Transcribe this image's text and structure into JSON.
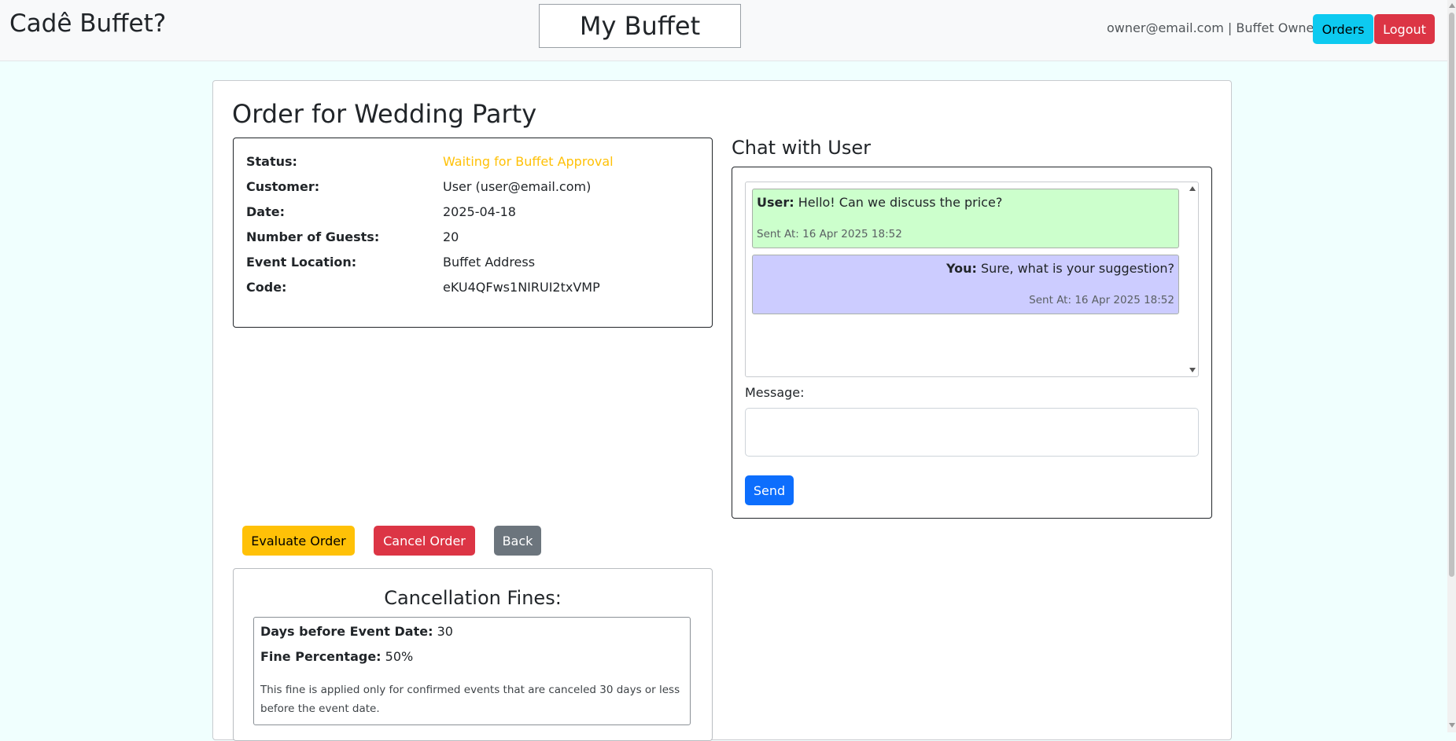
{
  "navbar": {
    "brand": "Cadê Buffet?",
    "my_buffet": "My Buffet",
    "user_info": "owner@email.com | Buffet Owner",
    "orders_label": "Orders",
    "logout_label": "Logout"
  },
  "page": {
    "title": "Order for Wedding Party"
  },
  "details": [
    {
      "label": "Status:",
      "value": "Waiting for Buffet Approval"
    },
    {
      "label": "Customer:",
      "value": "User (user@email.com)"
    },
    {
      "label": "Date:",
      "value": "2025-04-18"
    },
    {
      "label": "Number of Guests:",
      "value": "20"
    },
    {
      "label": "Event Location:",
      "value": "Buffet Address"
    },
    {
      "label": "Code:",
      "value": "eKU4QFws1NIRUI2txVMP"
    }
  ],
  "colors": {
    "status": "#ffc107",
    "user_message_bg": "#ccffcc",
    "own_message_bg": "#ccccff"
  },
  "chat": {
    "title": "Chat with User",
    "messages": [
      {
        "author": "User:",
        "text": " Hello! Can we discuss the price?",
        "sent": "Sent At: 16 Apr 2025 18:52"
      },
      {
        "author": "You:",
        "text": " Sure, what is your suggestion?",
        "sent": "Sent At: 16 Apr 2025 18:52"
      }
    ],
    "message_label": "Message:",
    "message_value": "",
    "send_label": "Send"
  },
  "actions": {
    "evaluate_label": "Evaluate Order",
    "cancel_label": "Cancel Order",
    "back_label": "Back"
  },
  "fines": {
    "title": "Cancellation Fines:",
    "days_label": "Days before Event Date:",
    "days_value": " 30",
    "percentage_label": "Fine Percentage:",
    "percentage_value": " 50%",
    "note": "This fine is applied only for confirmed events that are canceled 30 days or less before the event date."
  }
}
